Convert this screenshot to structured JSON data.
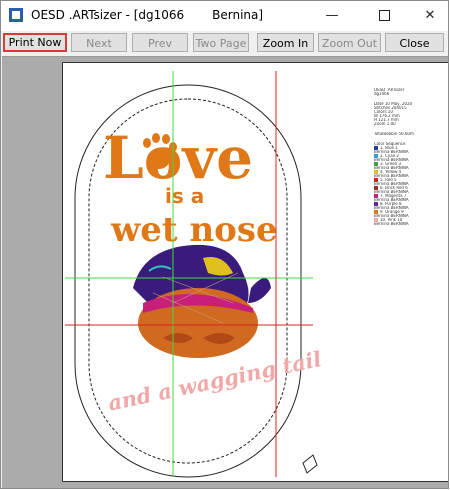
{
  "window": {
    "app_title": "OESD .ARTsizer - [dg1066",
    "sub_title": "Bernina]",
    "minimize_glyph": "—",
    "close_glyph": "✕"
  },
  "toolbar": {
    "print_now": "Print Now",
    "next_page": "Next Page",
    "prev_page": "Prev Page",
    "two_page": "Two Page",
    "zoom_in": "Zoom In",
    "zoom_out": "Zoom Out",
    "close": "Close"
  },
  "design": {
    "line1": "Love",
    "line2": "is a",
    "line3": "wet nose",
    "line4": "and a wagging tail",
    "colors": {
      "orange": "#e07818",
      "pink": "#f0a8a8",
      "purple": "#3a1a7a",
      "magenta": "#c8207a",
      "guide_green": "#40d840",
      "guide_red": "#e02020"
    }
  },
  "info_panel": {
    "header": "OESD .ARTsizer",
    "filename": "dg1066",
    "date": "Date 10 May, 2020",
    "stitches": "Stitches 204015",
    "colors": "Colors 10",
    "width": "W 176.2 mm",
    "height": "H 121.7 mm",
    "zoom": "Zoom 1.00",
    "total_bobbin": "TotalBobbin 56.60m",
    "color_sequence_title": "Color Sequence",
    "sequence": [
      {
        "label": "1. Blue 1",
        "brand": "Bernina BERNINA",
        "color": "#2040a0"
      },
      {
        "label": "2. Cyan 2",
        "brand": "Bernina BERNINA",
        "color": "#30a0d0"
      },
      {
        "label": "3. Green 3",
        "brand": "Bernina BERNINA",
        "color": "#40a040"
      },
      {
        "label": "4. Yellow 4",
        "brand": "Bernina BERNINA",
        "color": "#e0c020"
      },
      {
        "label": "5. Red 5",
        "brand": "Bernina BERNINA",
        "color": "#d02020"
      },
      {
        "label": "6. Brick Red 6",
        "brand": "Bernina BERNINA",
        "color": "#a03020"
      },
      {
        "label": "7. Magenta 7",
        "brand": "Bernina BERNINA",
        "color": "#c8207a"
      },
      {
        "label": "8. Purple 8",
        "brand": "Bernina BERNINA",
        "color": "#5a2a9a"
      },
      {
        "label": "9. Orange 9",
        "brand": "Bernina BERNINA",
        "color": "#e07818"
      },
      {
        "label": "10. Pink 10",
        "brand": "Bernina BERNINA",
        "color": "#f0a8a8"
      }
    ]
  }
}
